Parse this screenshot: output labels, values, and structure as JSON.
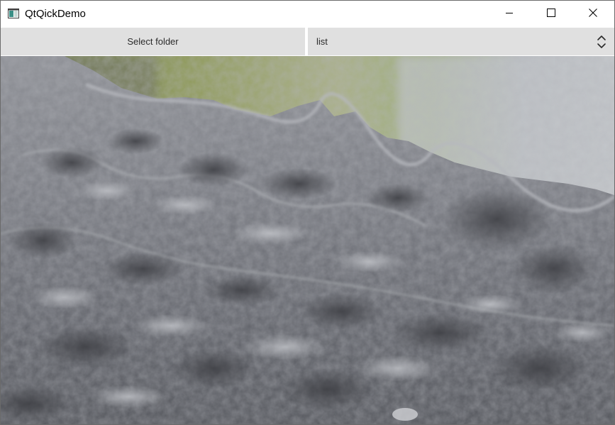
{
  "window": {
    "title": "QtQickDemo",
    "icon": "app-window-icon"
  },
  "titlebar_controls": {
    "minimize_icon": "minimize-icon",
    "maximize_icon": "maximize-icon",
    "close_icon": "close-icon"
  },
  "toolbar": {
    "select_folder_label": "Select folder",
    "view_mode_value": "list",
    "view_mode_indicator_icon": "up-down-chevron-icon"
  },
  "content": {
    "image_subject": "close-up photograph of porous grey rock"
  },
  "colors": {
    "toolbar_button_bg": "#e0e0e0",
    "titlebar_bg": "#ffffff",
    "window_border": "#6b6b6b"
  }
}
